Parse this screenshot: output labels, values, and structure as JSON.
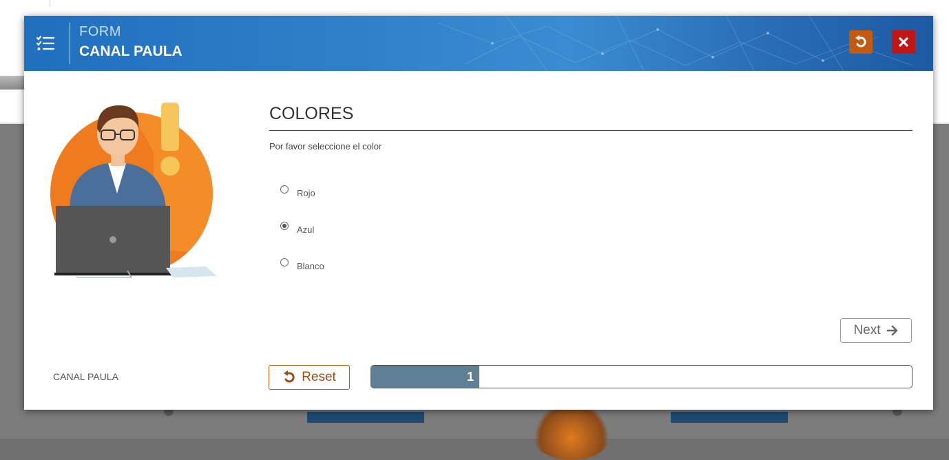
{
  "header": {
    "subtitle": "FORM",
    "title": "CANAL PAULA"
  },
  "sidebar": {
    "footer_label": "CANAL PAULA"
  },
  "form": {
    "title": "COLORES",
    "description": "Por favor seleccione el color",
    "options": [
      {
        "label": "Rojo",
        "selected": false
      },
      {
        "label": "Azul",
        "selected": true
      },
      {
        "label": "Blanco",
        "selected": false
      }
    ]
  },
  "buttons": {
    "next_label": "Next",
    "reset_label": "Reset"
  },
  "progress": {
    "page": "1",
    "fraction": 0.2
  },
  "icons": {
    "menu": "checklist-menu-icon",
    "undo": "undo-icon",
    "close": "close-icon",
    "next": "arrow-right-icon"
  },
  "colors": {
    "header_blue": "#2f7fc8",
    "undo_orange": "#c25a10",
    "close_red": "#c01616",
    "progress_fill": "#5f7f95"
  }
}
